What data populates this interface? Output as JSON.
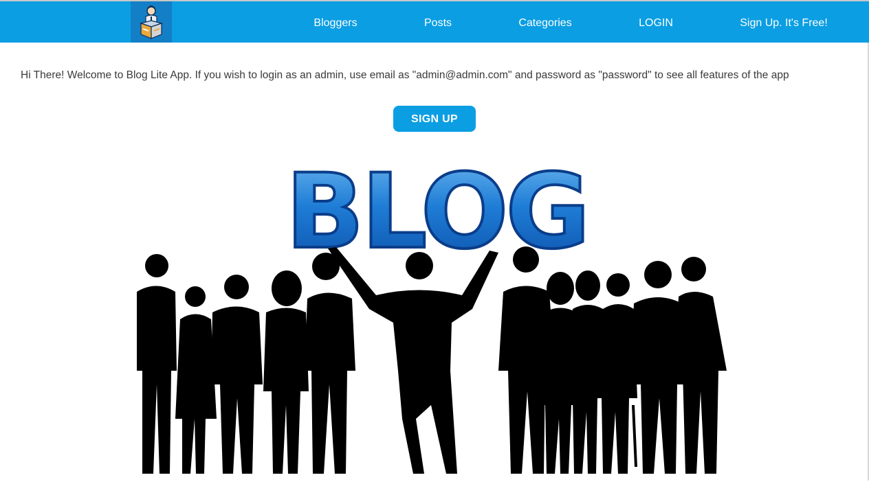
{
  "header": {
    "logo_icon": "blogger-box-logo",
    "brand_color": "#0b9ee3",
    "nav": [
      {
        "label": "Bloggers"
      },
      {
        "label": "Posts"
      },
      {
        "label": "Categories"
      },
      {
        "label": "LOGIN"
      },
      {
        "label": "Sign Up. It's Free!"
      }
    ]
  },
  "main": {
    "welcome_text": "Hi There! Welcome to Blog Lite App. If you wish to login as an admin, use email as \"admin@admin.com\" and password as \"password\" to see all features of the app",
    "signup_button": "SIGN UP",
    "hero": {
      "word": "BLOG",
      "image": "people-silhouettes-blog-illustration"
    }
  }
}
